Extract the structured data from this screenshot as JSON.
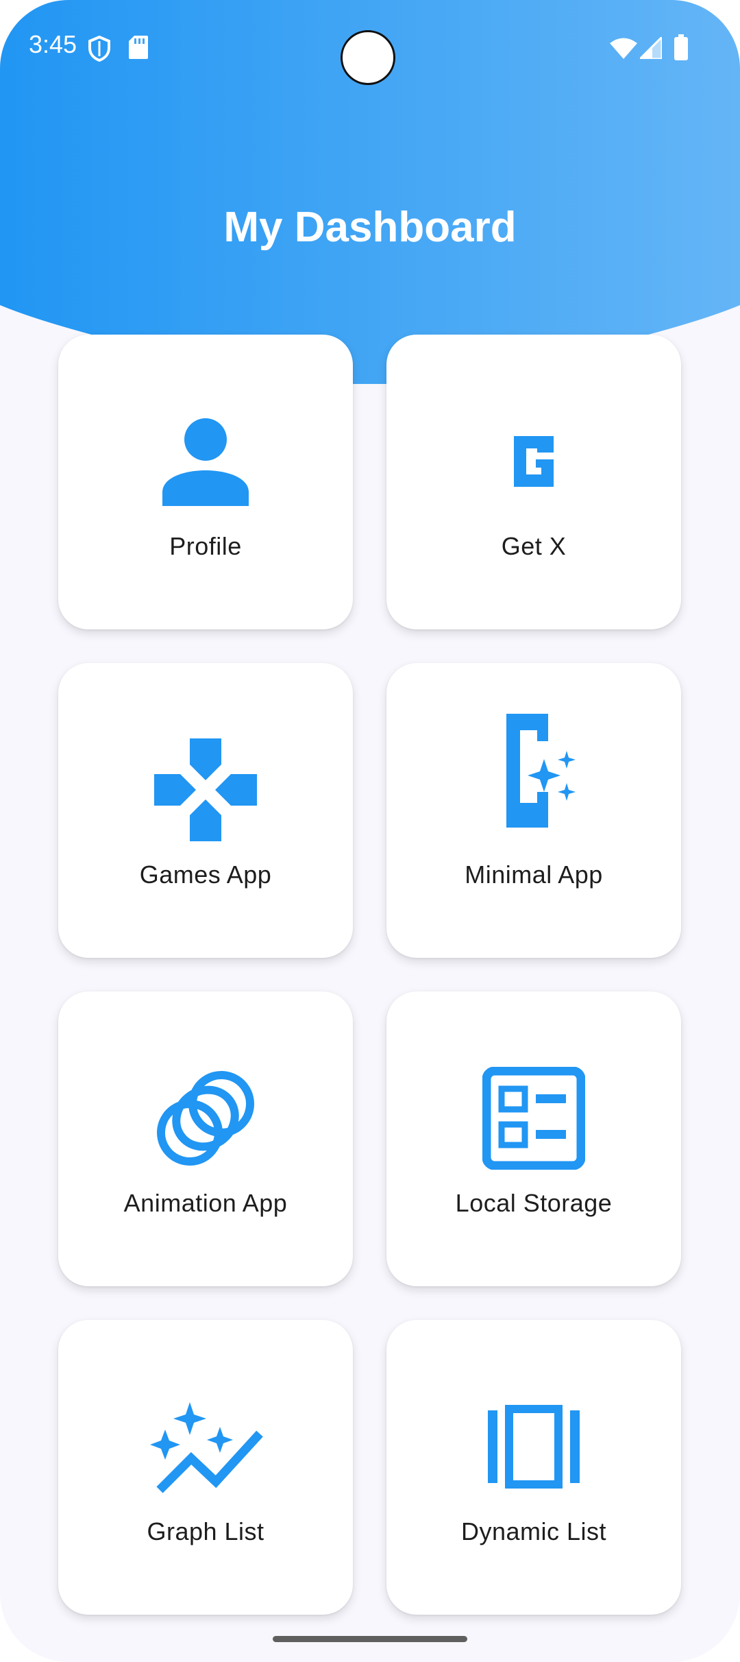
{
  "status_bar": {
    "time": "3:45",
    "left_icons": [
      "shield-icon",
      "sd-card-icon"
    ],
    "right_icons": [
      "wifi-icon",
      "signal-icon",
      "battery-icon"
    ]
  },
  "header": {
    "title": "My Dashboard",
    "gradient_start": "#2196f3",
    "gradient_end": "#64b5f6"
  },
  "accent_color": "#2196f3",
  "cards": [
    {
      "label": "Profile",
      "icon": "person-icon"
    },
    {
      "label": "Get X",
      "icon": "getx-logo-icon"
    },
    {
      "label": "Games App",
      "icon": "gamepad-icon"
    },
    {
      "label": "Minimal App",
      "icon": "device-sparkle-icon"
    },
    {
      "label": "Animation App",
      "icon": "rings-icon"
    },
    {
      "label": "Local Storage",
      "icon": "storage-list-icon"
    },
    {
      "label": "Graph List",
      "icon": "sparkle-chart-icon"
    },
    {
      "label": "Dynamic List",
      "icon": "view-array-icon"
    }
  ]
}
